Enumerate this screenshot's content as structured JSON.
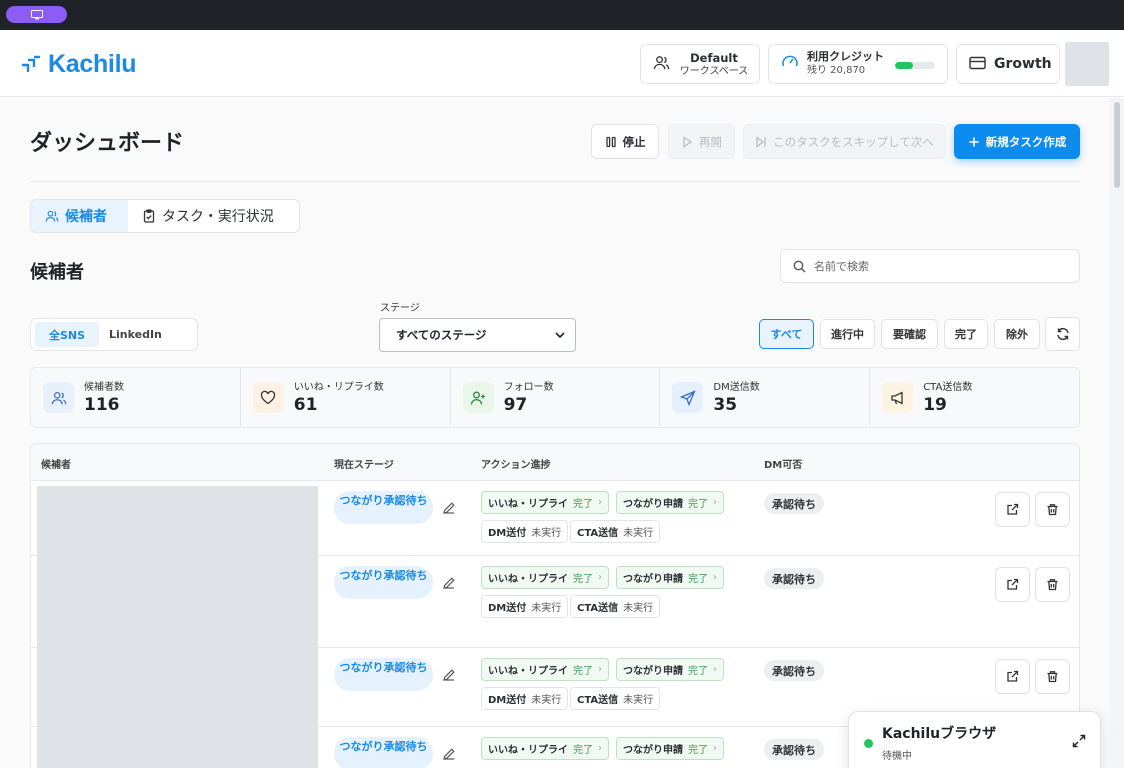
{
  "app": {
    "logo_text": "Kachilu"
  },
  "header": {
    "workspace": {
      "title": "Default",
      "subtitle": "ワークスペース"
    },
    "credits": {
      "title": "利用クレジット",
      "remaining": "残り 20,870",
      "fill_fraction": 0.45,
      "fill_color": "#22c55e"
    },
    "plan": {
      "label": "Growth"
    }
  },
  "dashboard": {
    "title": "ダッシュボード",
    "buttons": {
      "stop": "停止",
      "resume": "再開",
      "skip": "このタスクをスキップして次へ",
      "new_task": "新規タスク作成"
    },
    "tabs": [
      {
        "label": "候補者",
        "active": true
      },
      {
        "label": "タスク・実行状況",
        "active": false
      }
    ]
  },
  "candidates": {
    "title": "候補者",
    "search_placeholder": "名前で検索",
    "sns_filters": [
      {
        "label": "全SNS",
        "active": true
      },
      {
        "label": "LinkedIn",
        "active": false
      }
    ],
    "stage_label": "ステージ",
    "stage_value": "すべてのステージ",
    "status_filters": [
      "すべて",
      "進行中",
      "要確認",
      "完了",
      "除外"
    ],
    "active_status_filter": "すべて"
  },
  "stats": [
    {
      "label": "候補者数",
      "value": "116",
      "icon": "users-icon",
      "color": "#e8f0fb"
    },
    {
      "label": "いいね・リプライ数",
      "value": "61",
      "icon": "heart-icon",
      "color": "#fdf1e6"
    },
    {
      "label": "フォロー数",
      "value": "97",
      "icon": "user-plus-icon",
      "color": "#e8f7ea"
    },
    {
      "label": "DM送信数",
      "value": "35",
      "icon": "send-icon",
      "color": "#e6effc"
    },
    {
      "label": "CTA送信数",
      "value": "19",
      "icon": "megaphone-icon",
      "color": "#fdf3e1"
    }
  ],
  "table": {
    "columns": [
      "候補者",
      "現在ステージ",
      "アクション進捗",
      "DM可否"
    ],
    "rows": [
      {
        "stage": "つながり承認待ち",
        "actions": [
          {
            "name": "いいね・リプライ",
            "status": "完了"
          },
          {
            "name": "つながり申請",
            "status": "完了"
          },
          {
            "name": "DM送付",
            "status": "未実行"
          },
          {
            "name": "CTA送信",
            "status": "未実行"
          }
        ],
        "dm": "承認待ち"
      },
      {
        "stage": "つながり承認待ち",
        "actions": [
          {
            "name": "いいね・リプライ",
            "status": "完了"
          },
          {
            "name": "つながり申請",
            "status": "完了"
          },
          {
            "name": "DM送付",
            "status": "未実行"
          },
          {
            "name": "CTA送信",
            "status": "未実行"
          }
        ],
        "dm": "承認待ち"
      },
      {
        "stage": "つながり承認待ち",
        "actions": [
          {
            "name": "いいね・リプライ",
            "status": "完了"
          },
          {
            "name": "つながり申請",
            "status": "完了"
          },
          {
            "name": "DM送付",
            "status": "未実行"
          },
          {
            "name": "CTA送信",
            "status": "未実行"
          }
        ],
        "dm": "承認待ち"
      },
      {
        "stage": "つながり承認待ち",
        "actions": [
          {
            "name": "いいね・リプライ",
            "status": "完了"
          },
          {
            "name": "つながり申請",
            "status": "完了"
          }
        ],
        "dm": "承認待ち"
      }
    ]
  },
  "browser_widget": {
    "title": "Kachiluブラウザ",
    "status": "待機中",
    "status_color": "#22c55e"
  },
  "colors": {
    "accent": "#1b8ae6",
    "primary_button": "#0d8cf0",
    "success": "#3c9a50"
  }
}
